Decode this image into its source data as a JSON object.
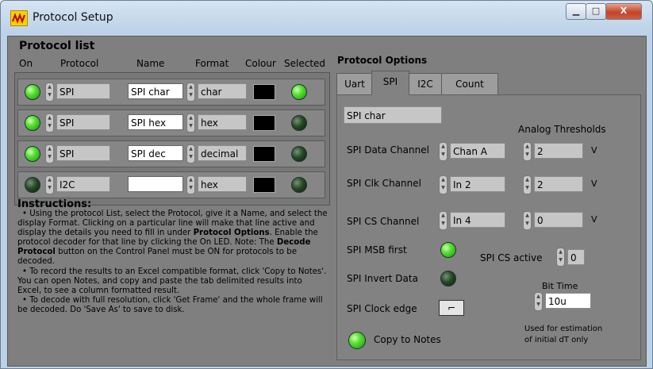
{
  "window": {
    "title": "Protocol Setup",
    "min_label": "▁",
    "max_label": "□",
    "close_label": "X"
  },
  "protocol_list": {
    "title": "Protocol list",
    "headers": [
      "On",
      "Protocol",
      "Name",
      "Format",
      "Colour",
      "Selected"
    ],
    "rows": [
      {
        "on": true,
        "protocol": "SPI",
        "name": "SPI char",
        "format": "char",
        "colour": "#000000",
        "selected": true
      },
      {
        "on": true,
        "protocol": "SPI",
        "name": "SPI hex",
        "format": "hex",
        "colour": "#000000",
        "selected": false
      },
      {
        "on": true,
        "protocol": "SPI",
        "name": "SPI dec",
        "format": "decimal",
        "colour": "#000000",
        "selected": false
      },
      {
        "on": false,
        "protocol": "I2C",
        "name": "",
        "format": "hex",
        "colour": "#000000",
        "selected": false
      }
    ]
  },
  "instructions": {
    "title": "Instructions:",
    "p1_a": "• Using the protocol List, select the Protocol, give it a Name, and select the display Format. Clicking on a particular line will make that line active and display the details you need to fill in under ",
    "p1_b": "Protocol Options",
    "p1_c": ". Enable the protocol decoder for that line by clicking the On LED. Note: The ",
    "p1_d": "Decode Protocol",
    "p1_e": " button on the Control Panel must be ON for protocols to be decoded.",
    "p2": "• To record the results to an Excel compatible format, click 'Copy to Notes'. You can open Notes, and copy and paste the tab delimited results into Excel, to see a column formatted result.",
    "p3": "• To decode with full resolution, click 'Get Frame' and the whole frame will be decoded. Do 'Save As' to save to disk."
  },
  "protocol_options": {
    "title": "Protocol Options",
    "tabs": [
      "Uart",
      "SPI",
      "I2C",
      "Count"
    ],
    "active_tab": "SPI",
    "name_display": "SPI char",
    "analog_thresholds_label": "Analog Thresholds",
    "data_channel_label": "SPI Data Channel",
    "data_channel_value": "Chan A",
    "clk_channel_label": "SPI Clk Channel",
    "clk_channel_value": "In 2",
    "cs_channel_label": "SPI CS Channel",
    "cs_channel_value": "In 4",
    "threshold_data": "2",
    "threshold_clk": "2",
    "threshold_cs": "0",
    "unit": "V",
    "msb_first_label": "SPI MSB first",
    "msb_first": true,
    "cs_active_label": "SPI CS active",
    "cs_active_value": "0",
    "invert_data_label": "SPI Invert Data",
    "invert_data": false,
    "bit_time_label": "Bit Time",
    "bit_time_value": "10u",
    "clock_edge_label": "SPI Clock edge",
    "clock_edge_symbol": "⌐",
    "copy_to_notes_label": "Copy to Notes",
    "estimation_note_1": "Used for estimation",
    "estimation_note_2": "of initial dT only"
  }
}
